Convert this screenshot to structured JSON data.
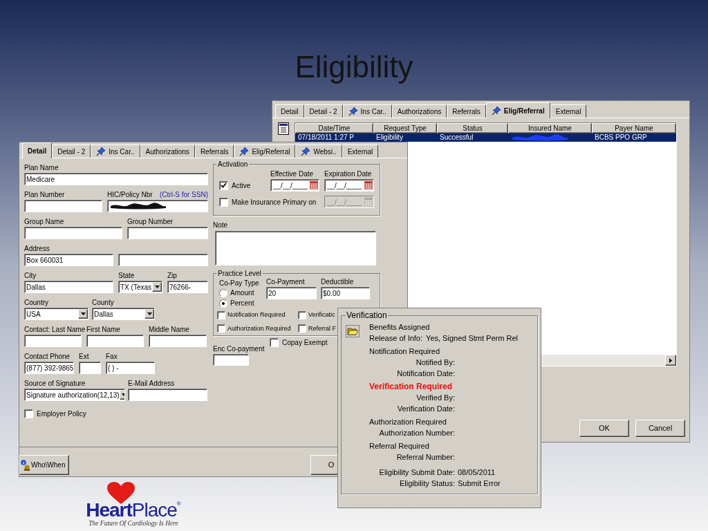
{
  "slide": {
    "title": "Eligibility"
  },
  "back_window": {
    "tabs": [
      {
        "label": "Detail",
        "pinned": false,
        "selected": false
      },
      {
        "label": "Detail - 2",
        "pinned": false,
        "selected": false
      },
      {
        "label": "Ins Car..",
        "pinned": true,
        "selected": false
      },
      {
        "label": "Authorizations",
        "pinned": false,
        "selected": false
      },
      {
        "label": "Referrals",
        "pinned": false,
        "selected": false
      },
      {
        "label": "Elig/Referral",
        "pinned": true,
        "selected": true
      },
      {
        "label": "External",
        "pinned": false,
        "selected": false
      }
    ],
    "table": {
      "columns": [
        "Date/Time",
        "Request Type",
        "Status",
        "Insured Name",
        "Payer Name"
      ],
      "rows": [
        {
          "selected": true,
          "cells": [
            {
              "kind": "text",
              "text": "07/18/2011 1:27 P"
            },
            {
              "kind": "text",
              "text": "Eligibility"
            },
            {
              "kind": "text",
              "text": "Successful"
            },
            {
              "kind": "redacted"
            },
            {
              "kind": "text",
              "text": "BCBS PPO GRP"
            }
          ]
        }
      ]
    },
    "buttons": [
      "OK",
      "Cancel"
    ]
  },
  "front_window": {
    "tabs": [
      {
        "label": "Detail",
        "pinned": false,
        "selected": true
      },
      {
        "label": "Detail - 2",
        "pinned": false,
        "selected": false
      },
      {
        "label": "Ins Car..",
        "pinned": true,
        "selected": false
      },
      {
        "label": "Authorizations",
        "pinned": false,
        "selected": false
      },
      {
        "label": "Referrals",
        "pinned": false,
        "selected": false
      },
      {
        "label": "Elig/Referral",
        "pinned": true,
        "selected": false
      },
      {
        "label": "Websi..",
        "pinned": true,
        "selected": false
      },
      {
        "label": "External",
        "pinned": false,
        "selected": false
      }
    ],
    "form": {
      "plan_name": {
        "label": "Plan Name",
        "value": "Medicare"
      },
      "plan_number": {
        "label": "Plan Number"
      },
      "hic_policy": {
        "label": "HIC/Policy Nbr",
        "hint": "(Ctrl-S for SSN)",
        "redacted": true
      },
      "group_name": {
        "label": "Group Name"
      },
      "group_number": {
        "label": "Group Number"
      },
      "address": {
        "label": "Address",
        "value": "Box 660031"
      },
      "city": {
        "label": "City",
        "value": "Dallas"
      },
      "state": {
        "label": "State",
        "value": "TX (Texas"
      },
      "zip": {
        "label": "Zip",
        "value": "76266-"
      },
      "country": {
        "label": "Country",
        "value": "USA"
      },
      "county": {
        "label": "County",
        "value": "Dallas"
      },
      "contact_last_name": {
        "label": "Contact: Last Name"
      },
      "first_name": {
        "label": "First Name"
      },
      "middle_name": {
        "label": "Middle Name"
      },
      "contact_phone": {
        "label": "Contact Phone",
        "value": "(877) 392-9865"
      },
      "ext": {
        "label": "Ext"
      },
      "fax": {
        "label": "Fax",
        "value": "(  )     -"
      },
      "source_of_signature": {
        "label": "Source of Signature",
        "value": "Signature authorization(12,13)"
      },
      "email": {
        "label": "E-Mail Address"
      },
      "employer_policy": {
        "label": "Employer Policy",
        "checked": false
      }
    },
    "activation": {
      "title": "Activation",
      "active": {
        "label": "Active",
        "checked": true
      },
      "effective_date": {
        "label": "Effective Date",
        "value": "__/__/____"
      },
      "expiration_date": {
        "label": "Expiration Date",
        "value": "__/__/____"
      },
      "make_primary": {
        "label": "Make Insurance Primary on",
        "checked": false
      },
      "primary_date": {
        "value": "__/__/____",
        "disabled": true
      }
    },
    "note": {
      "label": "Note"
    },
    "practice_level": {
      "title": "Practice Level",
      "copay_type": {
        "label": "Co-Pay Type",
        "options": [
          {
            "label": "Amount",
            "selected": false
          },
          {
            "label": "Percent",
            "selected": true
          }
        ]
      },
      "copayment": {
        "label": "Co-Payment",
        "value": "20"
      },
      "deductible": {
        "label": "Deductible",
        "value": "$0.00"
      },
      "checks": [
        {
          "label": "Notification Required",
          "checked": false
        },
        {
          "label": "Verificatic",
          "checked": false
        },
        {
          "label": "Authorization Required",
          "checked": false
        },
        {
          "label": "Referral F",
          "checked": false
        }
      ]
    },
    "enc_copayment": {
      "label": "Enc Co-payment"
    },
    "copay_exempt": {
      "label": "Copay Exempt",
      "checked": false
    },
    "who_when_button": "Who\\When",
    "ok_button": "O"
  },
  "verification": {
    "title": "Verification",
    "benefits": "Benefits Assigned",
    "release": {
      "label": "Release of Info:",
      "value": "Yes, Signed Stmt Perm Rel"
    },
    "sections": [
      {
        "heading": "Notification Required",
        "alert": false,
        "fields": [
          "Notified By:",
          "Notification Date:"
        ]
      },
      {
        "heading": "Verification Required",
        "alert": true,
        "fields": [
          "Verified By:",
          "Verification Date:"
        ]
      },
      {
        "heading": "Authorization Required",
        "alert": false,
        "fields": [
          "Authorization Number:"
        ]
      },
      {
        "heading": "Referral Required",
        "alert": false,
        "fields": [
          "Referral Number:"
        ]
      }
    ],
    "summary": [
      {
        "label": "Eligibility Submit Date:",
        "value": "08/05/2011"
      },
      {
        "label": "Eligibility Status:",
        "value": "Submit Error"
      }
    ]
  },
  "logo": {
    "name": "**Heart**Place",
    "registered": "®",
    "tagline": "The Future Of Cardiology Is Here"
  }
}
